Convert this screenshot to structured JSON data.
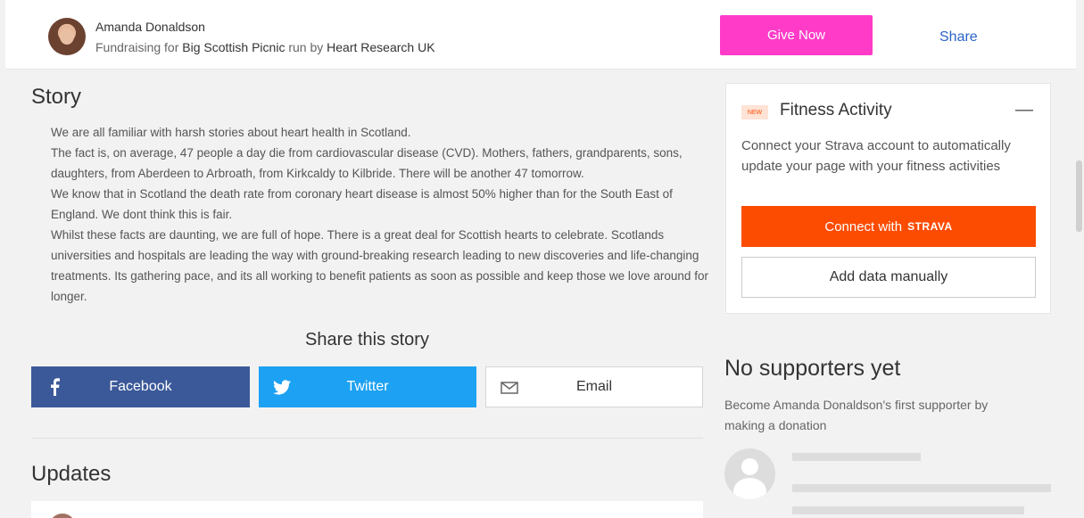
{
  "header": {
    "user_name": "Amanda Donaldson",
    "fundraising_prefix": "Fundraising for",
    "event_name": "Big Scottish Picnic",
    "run_by_prefix": "run by",
    "charity_name": "Heart Research UK",
    "give_label": "Give Now",
    "share_label": "Share"
  },
  "story": {
    "title": "Story",
    "paragraphs": [
      "We are all familiar with harsh stories about heart health in Scotland.",
      "The fact is, on average, 47 people a day die from cardiovascular disease (CVD). Mothers, fathers, grandparents, sons, daughters, from Aberdeen to Arbroath, from Kirkcaldy to Kilbride. There will be another 47 tomorrow.",
      "We know that in Scotland the death rate from coronary heart disease is almost 50% higher than for the South East of England. We dont think this is fair.",
      "Whilst these facts are daunting, we are full of hope. There is a great deal for Scottish hearts to celebrate. Scotlands universities and hospitals are leading the way with ground-breaking research leading to new discoveries and life-changing treatments. Its gathering pace, and its all working to benefit patients as soon as possible and keep those we love around for longer."
    ]
  },
  "share": {
    "title": "Share this story",
    "facebook_label": "Facebook",
    "twitter_label": "Twitter",
    "email_label": "Email"
  },
  "updates": {
    "title": "Updates"
  },
  "fitness": {
    "badge": "NEW",
    "title": "Fitness Activity",
    "collapse_symbol": "—",
    "description": "Connect your Strava account to automatically update your page with your fitness activities",
    "connect_label": "Connect with",
    "strava_logo": "STRAVA",
    "manual_label": "Add data manually"
  },
  "supporters": {
    "title": "No supporters yet",
    "description": "Become Amanda Donaldson's first supporter by making a donation"
  },
  "colors": {
    "give_pink": "#ff3bc8",
    "facebook_blue": "#3b5998",
    "twitter_blue": "#1da1f2",
    "strava_orange": "#fc4c02",
    "link_blue": "#2a63c7"
  },
  "icons": {
    "facebook": "facebook-icon",
    "twitter": "twitter-icon",
    "email": "email-icon",
    "avatar_placeholder": "user-placeholder-icon"
  }
}
